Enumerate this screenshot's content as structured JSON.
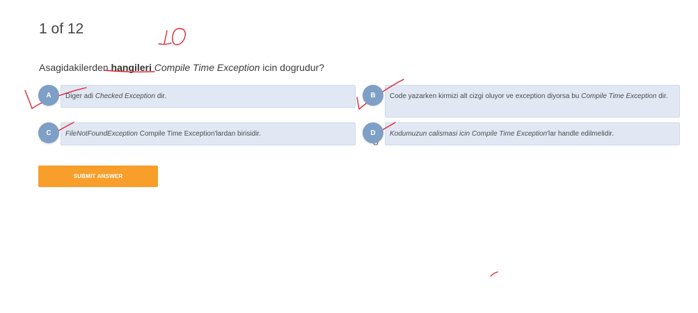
{
  "counter": "1 of 12",
  "question": {
    "prefix": "Asagidakilerden ",
    "bold": "hangileri",
    "space": " ",
    "italic": "Compile Time Exception",
    "suffix": " icin dogrudur?"
  },
  "options": [
    {
      "letter": "A",
      "parts": [
        "Diger adi ",
        "Checked Exception",
        " dir."
      ]
    },
    {
      "letter": "B",
      "parts": [
        "Code yazarken kirmizi alt cizgi oluyor ve exception diyorsa bu ",
        "Compile Time Exception",
        " dir."
      ]
    },
    {
      "letter": "C",
      "parts": [
        "FileNotFoundException",
        " Compile Time Exception'lardan birisidir."
      ]
    },
    {
      "letter": "D",
      "parts": [
        "Kodumuzun calismasi icin Compile Time Exception",
        "'lar handle edilmelidir."
      ]
    }
  ],
  "submit_label": "SUBMIT ANSWER",
  "annotation": {
    "handwritten_score": "10"
  },
  "colors": {
    "badge": "#7e9fc6",
    "option_bg": "#e1e8f4",
    "submit": "#f89e2a",
    "ink": "#e0242f"
  }
}
